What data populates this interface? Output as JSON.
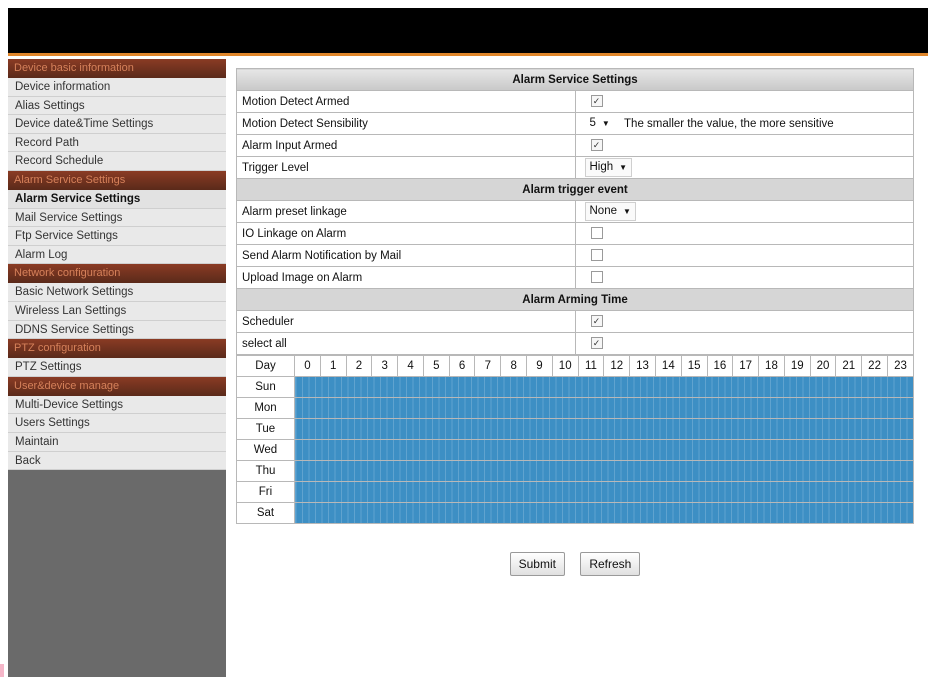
{
  "sidebar": {
    "sections": [
      {
        "title": "Device basic information",
        "items": [
          "Device information",
          "Alias Settings",
          "Device date&Time Settings",
          "Record Path",
          "Record Schedule"
        ]
      },
      {
        "title": "Alarm Service Settings",
        "items": [
          "Alarm Service Settings",
          "Mail Service Settings",
          "Ftp Service Settings",
          "Alarm Log"
        ]
      },
      {
        "title": "Network configuration",
        "items": [
          "Basic Network Settings",
          "Wireless Lan Settings",
          "DDNS Service Settings"
        ]
      },
      {
        "title": "PTZ configuration",
        "items": [
          "PTZ Settings"
        ]
      },
      {
        "title": "User&device manage",
        "items": [
          "Multi-Device Settings",
          "Users Settings",
          "Maintain",
          "Back"
        ]
      }
    ],
    "active_item": "Alarm Service Settings"
  },
  "form": {
    "title": "Alarm Service Settings",
    "motion_detect_armed": {
      "label": "Motion Detect Armed",
      "checked": true
    },
    "motion_detect_sensibility": {
      "label": "Motion Detect Sensibility",
      "value": "5",
      "hint": "The smaller the value, the more sensitive"
    },
    "alarm_input_armed": {
      "label": "Alarm Input Armed",
      "checked": true
    },
    "trigger_level": {
      "label": "Trigger Level",
      "value": "High"
    },
    "trigger_event_title": "Alarm trigger event",
    "alarm_preset_linkage": {
      "label": "Alarm preset linkage",
      "value": "None"
    },
    "io_linkage": {
      "label": "IO Linkage on Alarm",
      "checked": false
    },
    "send_mail": {
      "label": "Send Alarm Notification by Mail",
      "checked": false
    },
    "upload_image": {
      "label": "Upload Image on Alarm",
      "checked": false
    },
    "arming_time_title": "Alarm Arming Time",
    "scheduler": {
      "label": "Scheduler",
      "checked": true
    },
    "select_all": {
      "label": "select all",
      "checked": true
    }
  },
  "schedule": {
    "day_header": "Day",
    "hours": [
      "0",
      "1",
      "2",
      "3",
      "4",
      "5",
      "6",
      "7",
      "8",
      "9",
      "10",
      "11",
      "12",
      "13",
      "14",
      "15",
      "16",
      "17",
      "18",
      "19",
      "20",
      "21",
      "22",
      "23"
    ],
    "days": [
      "Sun",
      "Mon",
      "Tue",
      "Wed",
      "Thu",
      "Fri",
      "Sat"
    ],
    "all_selected": true,
    "selected_color": "#3d8fc4"
  },
  "buttons": {
    "submit": "Submit",
    "refresh": "Refresh"
  },
  "colors": {
    "section_header": "#6b2e1d",
    "section_text": "#d6815a",
    "top_stripe": "#e0862a"
  },
  "icons": {
    "dropdown": "dropdown-arrow-icon",
    "checkbox": "checkbox-icon"
  }
}
